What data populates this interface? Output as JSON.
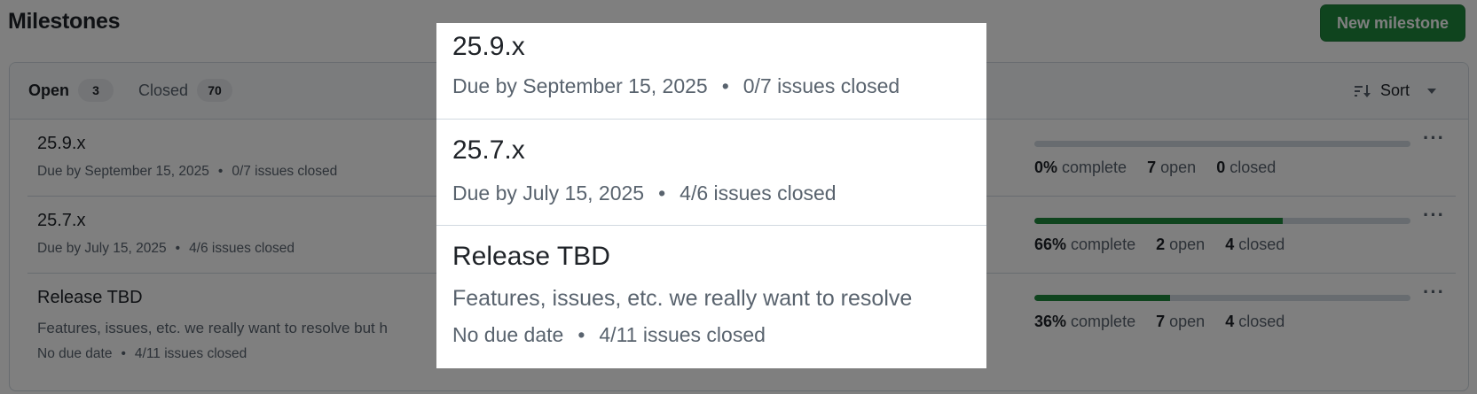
{
  "page": {
    "title": "Milestones",
    "new_button": "New milestone"
  },
  "states": {
    "open": {
      "label": "Open",
      "count": "3"
    },
    "closed": {
      "label": "Closed",
      "count": "70"
    }
  },
  "sort": {
    "label": "Sort"
  },
  "colors": {
    "accent": "#1f883d",
    "progress_track": "#d1d9e0",
    "muted_text": "#59636e"
  },
  "milestones": [
    {
      "title": "25.9.x",
      "due": "Due by September 15, 2025",
      "issues": "0/7 issues closed",
      "description": "",
      "progress_fraction": 0.0,
      "percent": "0%",
      "complete_label": "complete",
      "open_count": "7",
      "open_label": "open",
      "closed_count": "0",
      "closed_label": "closed"
    },
    {
      "title": "25.7.x",
      "due": "Due by July 15, 2025",
      "issues": "4/6 issues closed",
      "description": "",
      "progress_fraction": 0.66,
      "percent": "66%",
      "complete_label": "complete",
      "open_count": "2",
      "open_label": "open",
      "closed_count": "4",
      "closed_label": "closed"
    },
    {
      "title": "Release TBD",
      "due": "No due date",
      "issues": "4/11 issues closed",
      "description": "Features, issues, etc. we really want to resolve but h",
      "progress_fraction": 0.36,
      "percent": "36%",
      "complete_label": "complete",
      "open_count": "7",
      "open_label": "open",
      "closed_count": "4",
      "closed_label": "closed"
    }
  ],
  "zoom": {
    "rows": [
      {
        "title": "25.9.x",
        "due": "Due by September 15, 2025",
        "issues": "0/7 issues closed"
      },
      {
        "title": "25.7.x",
        "due": "Due by July 15, 2025",
        "issues": "4/6 issues closed"
      },
      {
        "title": "Release TBD",
        "description": "Features, issues, etc. we really want to resolve",
        "due": "No due date",
        "issues": "4/11 issues closed"
      }
    ]
  },
  "icons": {
    "sort": "sort-desc-icon",
    "caret": "triangle-down-icon",
    "kebab": "kebab-horizontal-icon",
    "separator": "•"
  }
}
